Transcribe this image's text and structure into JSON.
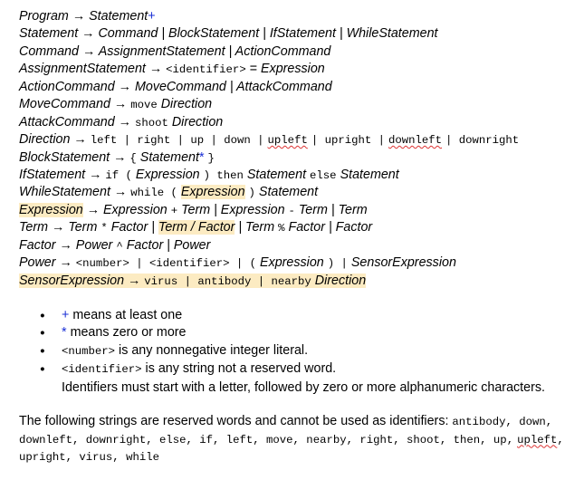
{
  "grammar": {
    "program": {
      "lhs": "Program",
      "rhs": "Statement",
      "plus": "+"
    },
    "statement": {
      "lhs": "Statement",
      "rhs": "Command | BlockStatement | IfStatement | WhileStatement"
    },
    "command": {
      "lhs": "Command",
      "rhs": "AssignmentStatement | ActionCommand"
    },
    "assignment": {
      "lhs": "AssignmentStatement",
      "tok_identifier": "<identifier>",
      "eq": "=",
      "rhs": "Expression"
    },
    "action": {
      "lhs": "ActionCommand",
      "rhs": "MoveCommand | AttackCommand"
    },
    "move": {
      "lhs": "MoveCommand",
      "kw": "move",
      "rhs": "Direction"
    },
    "attack": {
      "lhs": "AttackCommand",
      "kw": "shoot",
      "rhs": "Direction"
    },
    "direction": {
      "lhs": "Direction",
      "t1": "left | right | up | down |",
      "t2": "upleft",
      "t3": "| upright |",
      "t4": "downleft",
      "t5": "| downright"
    },
    "block": {
      "lhs": "BlockStatement",
      "open": "{",
      "stmt": "Statement",
      "star": "*",
      "close": "}"
    },
    "if": {
      "lhs": "IfStatement",
      "kw_if": "if (",
      "expr": "Expression",
      "kw_then": ") then",
      "stmt1": "Statement",
      "kw_else": "else",
      "stmt2": "Statement"
    },
    "while": {
      "lhs": "WhileStatement",
      "kw_while": "while (",
      "expr": "Expression",
      "close": ")",
      "stmt": "Statement"
    },
    "expression": {
      "lhs": "Expression",
      "p1": "Expression",
      "op1": "+",
      "p2": "Term | Expression",
      "op2": "-",
      "p3": "Term | Term"
    },
    "term": {
      "lhs": "Term",
      "p1": "Term",
      "op1": "*",
      "p2": "Factor |",
      "hl": "Term / Factor",
      "p3": "| Term",
      "op3": "%",
      "p4": "Factor | Factor"
    },
    "factor": {
      "lhs": "Factor",
      "p1": "Power",
      "op1": "^",
      "p2": "Factor | Power"
    },
    "power": {
      "lhs": "Power",
      "t1": "<number> | <identifier> | (",
      "expr": "Expression",
      "t2": ") |",
      "sensor": "SensorExpression"
    },
    "sensor": {
      "lhs": "SensorExpression",
      "arrow": "→",
      "t1": "virus | antibody | nearby",
      "dir": "Direction"
    },
    "arrow": "→"
  },
  "notes": {
    "b1_sym": "+",
    "b1_text": "means at least one",
    "b2_sym": "*",
    "b2_text": "means zero or more",
    "b3_tok": "<number>",
    "b3_text": "is any nonnegative integer literal.",
    "b4_tok": "<identifier>",
    "b4_text": "is any string not a reserved word.",
    "b4_cont": "Identifiers must start with a letter, followed by zero or more alphanumeric characters."
  },
  "reserved": {
    "intro": "The following strings are reserved words and cannot be used as identifiers:",
    "w1": "antibody, down, downleft, downright, else, if, left, move, nearby, right, shoot, then, up,",
    "w2": "upleft",
    "w3": ", upright, virus, while"
  },
  "colors": {
    "highlight": "#fcebc2",
    "plus_blue": "#1a2fd6",
    "squiggle": "#d33"
  }
}
